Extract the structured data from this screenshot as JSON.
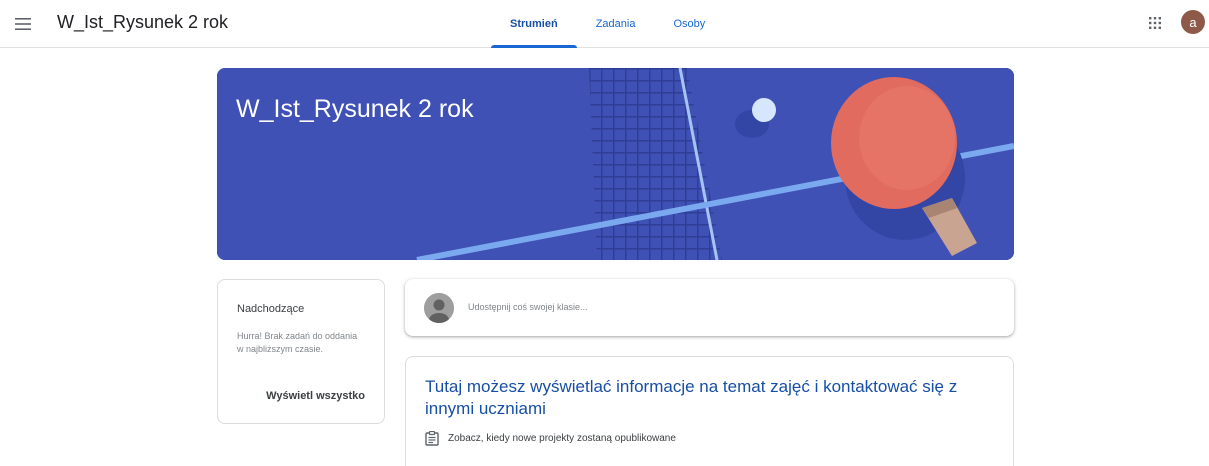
{
  "header": {
    "title": "W_Ist_Rysunek 2 rok",
    "avatar_letter": "a",
    "tabs": [
      {
        "label": "Strumień",
        "active": true
      },
      {
        "label": "Zadania",
        "active": false
      },
      {
        "label": "Osoby",
        "active": false
      }
    ]
  },
  "banner": {
    "title": "W_Ist_Rysunek 2 rok"
  },
  "upcoming": {
    "title": "Nadchodzące",
    "text": "Hurra! Brak zadań do oddania w najbliższym czasie.",
    "view_all": "Wyświetl wszystko"
  },
  "share": {
    "placeholder": "Udostępnij coś swojej klasie..."
  },
  "info": {
    "title": "Tutaj możesz wyświetlać informacje na temat zajęć i kontaktować się z innymi uczniami",
    "row_text": "Zobacz, kiedy nowe projekty zostaną opublikowane"
  },
  "colors": {
    "accent": "#1967d2",
    "banner_bg": "#3f51b5",
    "avatar_bg": "#8d5a4a"
  },
  "icons": {
    "menu": "menu-icon",
    "apps": "apps-grid-icon",
    "profile": "user-silhouette-icon",
    "assignment": "assignment-icon"
  }
}
